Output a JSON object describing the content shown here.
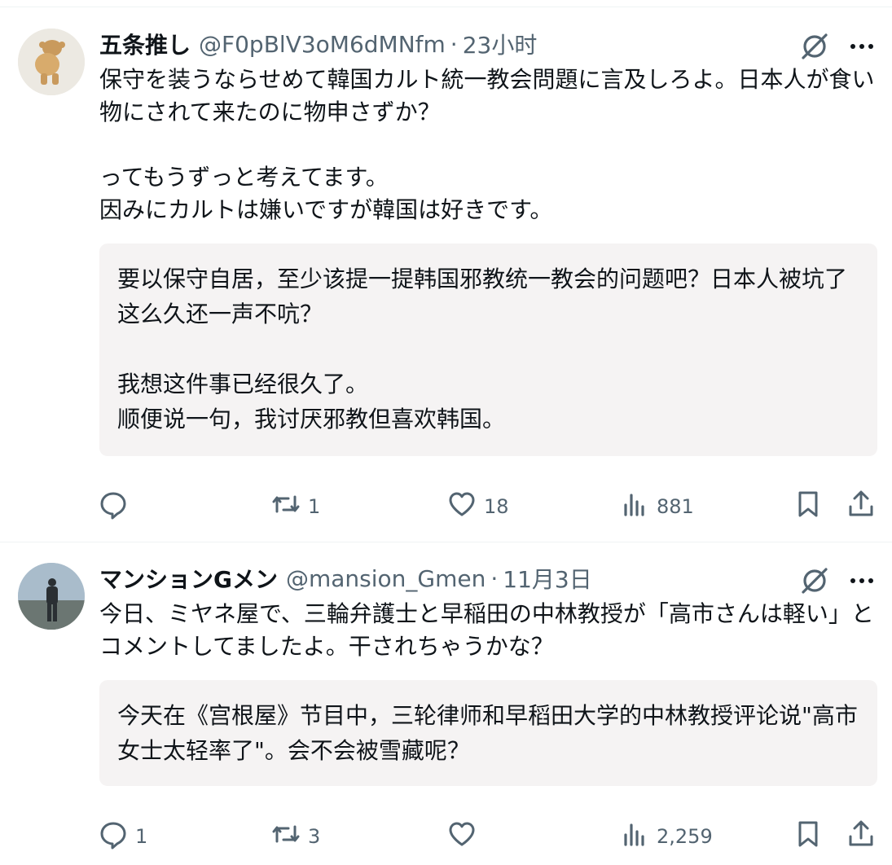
{
  "tweets": [
    {
      "name": "五条推し",
      "handle": "@F0pBlV3oM6dMNfm",
      "separator": "·",
      "time": "23小时",
      "text": "保守を装うならせめて韓国カルト統一教会問題に言及しろよ。日本人が食い物にされて来たのに物申さずか？\n\nってもうずっと考えてます。\n因みにカルトは嫌いですが韓国は好きです。",
      "translation": "要以保守自居，至少该提一提韩国邪教统一教会的问题吧？日本人被坑了这么久还一声不吭？\n\n我想这件事已经很久了。\n顺便说一句，我讨厌邪教但喜欢韩国。",
      "stats": {
        "replies": "",
        "retweets": "1",
        "likes": "18",
        "views": "881"
      }
    },
    {
      "name": "マンションGメン",
      "handle": "@mansion_Gmen",
      "separator": "·",
      "time": "11月3日",
      "text": "今日、ミヤネ屋で、三輪弁護士と早稲田の中林教授が「高市さんは軽い」とコメントしてましたよ。干されちゃうかな？",
      "translation": "今天在《宫根屋》节目中，三轮律师和早稻田大学的中林教授评论说\"高市女士太轻率了\"。会不会被雪藏呢？",
      "stats": {
        "replies": "1",
        "retweets": "3",
        "likes": "",
        "views": "2,259"
      }
    }
  ],
  "icons": {
    "reply": "reply-icon",
    "retweet": "retweet-icon",
    "like": "heart-icon",
    "views": "views-icon",
    "bookmark": "bookmark-icon",
    "share": "share-icon",
    "grok": "grok-icon",
    "more": "more-icon"
  },
  "colors": {
    "text": "#0f1419",
    "muted": "#536471",
    "translation_bg": "#f5f3f3"
  }
}
